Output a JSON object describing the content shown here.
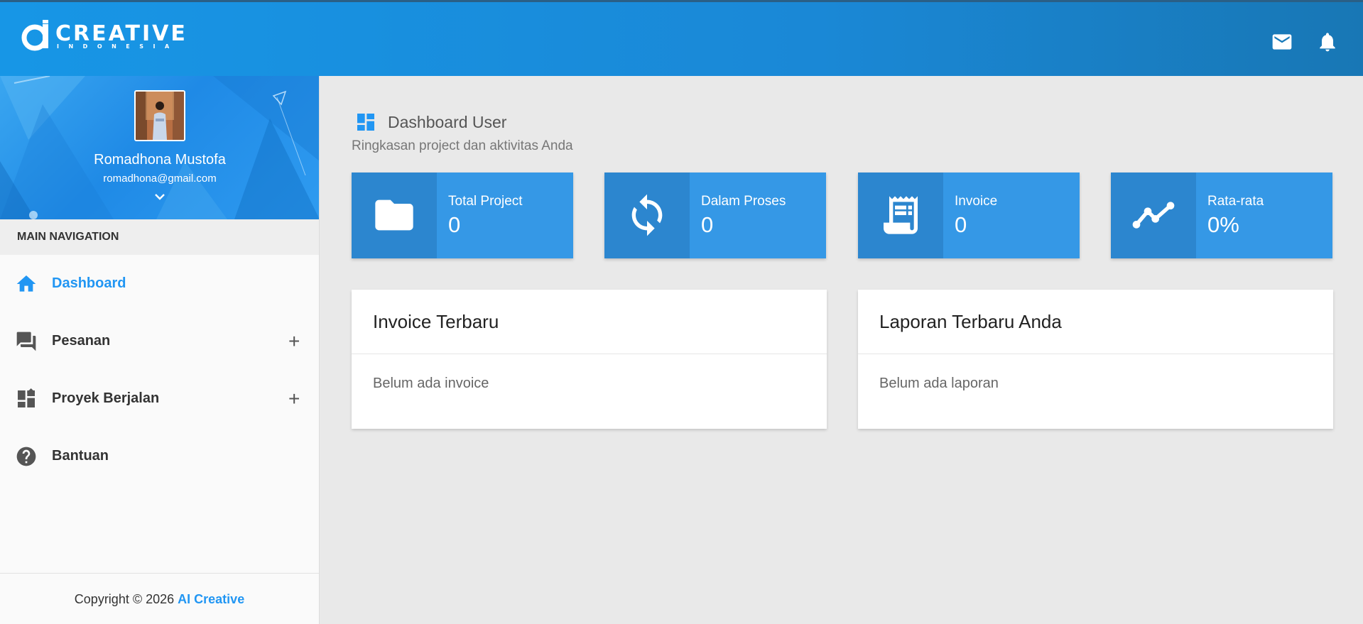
{
  "brand": {
    "logo_word": "CREATIVE",
    "logo_sub": "INDONESIA",
    "accent": "#2196f3"
  },
  "topbar": {
    "icons": [
      "mail-icon",
      "bell-icon"
    ]
  },
  "sidebar": {
    "user": {
      "name": "Romadhona Mustofa",
      "email": "romadhona@gmail.com"
    },
    "nav_header": "MAIN NAVIGATION",
    "items": [
      {
        "label": "Dashboard",
        "icon": "home-icon",
        "active": true
      },
      {
        "label": "Pesanan",
        "icon": "chat-icon",
        "expand": "+"
      },
      {
        "label": "Proyek Berjalan",
        "icon": "dashboard-icon",
        "expand": "+"
      },
      {
        "label": "Bantuan",
        "icon": "help-icon"
      }
    ],
    "footer": {
      "text": "Copyright © 2026",
      "brand": "AI Creative"
    }
  },
  "main": {
    "title": "Dashboard User",
    "subtitle": "Ringkasan project dan aktivitas Anda",
    "stats": [
      {
        "label": "Total Project",
        "value": "0",
        "icon": "folder-icon"
      },
      {
        "label": "Dalam Proses",
        "value": "0",
        "icon": "sync-icon"
      },
      {
        "label": "Invoice",
        "value": "0",
        "icon": "receipt-icon"
      },
      {
        "label": "Rata-rata",
        "value": "0%",
        "icon": "trending-icon"
      }
    ],
    "cards": [
      {
        "title": "Invoice Terbaru",
        "body": "Belum ada invoice"
      },
      {
        "title": "Laporan Terbaru Anda",
        "body": "Belum ada laporan"
      }
    ]
  }
}
